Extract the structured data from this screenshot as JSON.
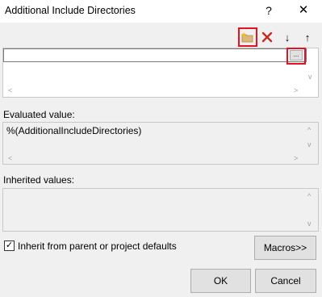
{
  "window": {
    "title": "Additional Include Directories",
    "help_label": "?",
    "close_label": "✕"
  },
  "toolbar": {
    "new_line_icon": "new-folder-icon",
    "delete_icon": "delete-x-icon",
    "move_down_label": "↓",
    "move_up_label": "↑"
  },
  "edit_list": {
    "current_value": "",
    "browse_label": "..."
  },
  "evaluated": {
    "label": "Evaluated value:",
    "value": "%(AdditionalIncludeDirectories)"
  },
  "inherited": {
    "label": "Inherited values:",
    "value": ""
  },
  "inherit_checkbox": {
    "label": "Inherit from parent or project defaults",
    "checked": true,
    "check_glyph": "✓"
  },
  "buttons": {
    "macros": "Macros>>",
    "ok": "OK",
    "cancel": "Cancel"
  },
  "scroll": {
    "up": "^",
    "down": "v",
    "left": "<",
    "right": ">"
  },
  "colors": {
    "highlight": "#e81123",
    "delete_red": "#c42b1c"
  }
}
